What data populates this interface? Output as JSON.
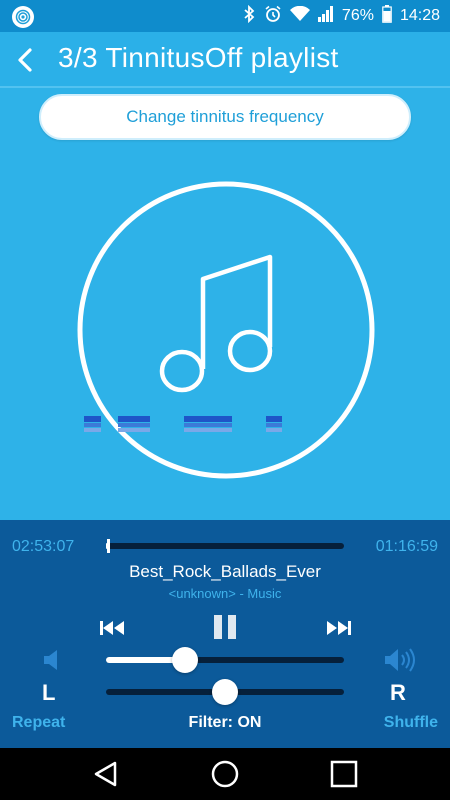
{
  "status_bar": {
    "battery": "76%",
    "time": "14:28",
    "icons": [
      "app-icon",
      "bluetooth-icon",
      "alarm-icon",
      "wifi-icon",
      "signal-icon",
      "battery-icon"
    ]
  },
  "header": {
    "title": "3/3  TinnitusOff playlist",
    "back_icon": "chevron-left-icon"
  },
  "main": {
    "change_frequency_label": "Change tinnitus frequency",
    "art_icon": "music-note-icon"
  },
  "player": {
    "elapsed": "02:53:07",
    "remaining": "01:16:59",
    "progress": 0.01,
    "track_title": "Best_Rock_Ballads_Ever",
    "track_subtitle": "<unknown> - Music",
    "volume_level": 0.33,
    "balance_level": 0.5,
    "left_label": "L",
    "right_label": "R",
    "repeat_label": "Repeat",
    "filter_label": "Filter: ON",
    "shuffle_label": "Shuffle"
  },
  "colors": {
    "accent": "#3fb3ec",
    "main_bg": "#2eb2e8",
    "player_bg": "#0c5a9a"
  }
}
